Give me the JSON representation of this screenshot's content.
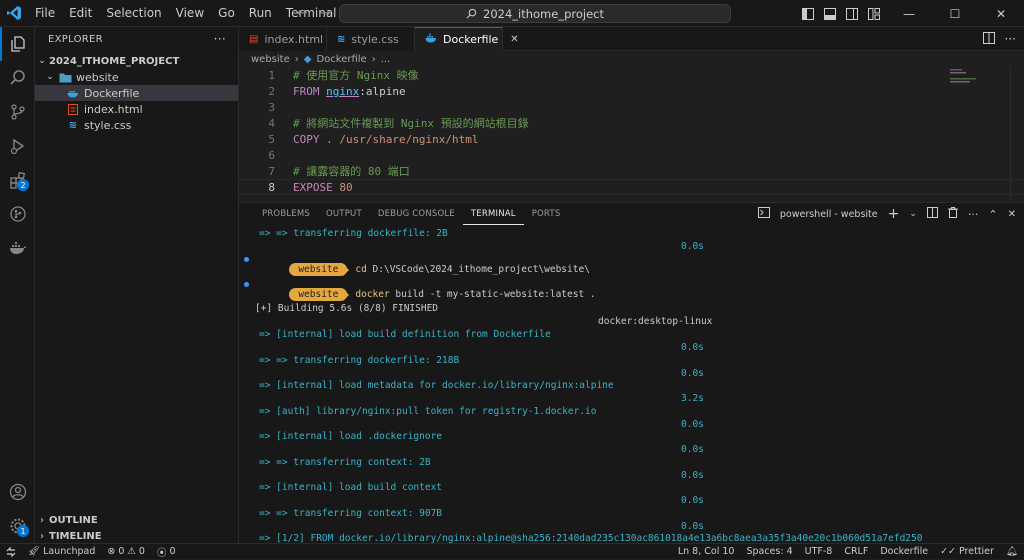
{
  "menu": [
    "File",
    "Edit",
    "Selection",
    "View",
    "Go",
    "Run",
    "Terminal",
    "Help"
  ],
  "command_center": "2024_ithome_project",
  "explorer": {
    "title": "EXPLORER",
    "project": "2024_ITHOME_PROJECT",
    "folder": "website",
    "files": [
      {
        "name": "Dockerfile",
        "icon": "docker-file-icon"
      },
      {
        "name": "index.html",
        "icon": "html-file-icon"
      },
      {
        "name": "style.css",
        "icon": "css-file-icon"
      }
    ],
    "outline": "OUTLINE",
    "timeline": "TIMELINE"
  },
  "tabs": [
    {
      "label": "index.html"
    },
    {
      "label": "style.css"
    },
    {
      "label": "Dockerfile"
    }
  ],
  "breadcrumb": {
    "folder": "website",
    "file": "Dockerfile",
    "tail": "..."
  },
  "code": [
    {
      "n": "1",
      "parts": [
        {
          "t": "# 使用官方 Nginx 映像",
          "c": "c-comment"
        }
      ]
    },
    {
      "n": "2",
      "parts": [
        {
          "t": "FROM ",
          "c": "c-kw"
        },
        {
          "t": "nginx",
          "c": "c-orange"
        },
        {
          "t": ":alpine",
          "c": "c-orange"
        }
      ]
    },
    {
      "n": "3",
      "parts": []
    },
    {
      "n": "4",
      "parts": [
        {
          "t": "# 將網站文件複製到 Nginx 預設的網站根目錄",
          "c": "c-comment"
        }
      ]
    },
    {
      "n": "5",
      "parts": [
        {
          "t": "COPY ",
          "c": "c-kw"
        },
        {
          "t": ". /usr/share/nginx/html",
          "c": "c-orange"
        }
      ]
    },
    {
      "n": "6",
      "parts": []
    },
    {
      "n": "7",
      "parts": [
        {
          "t": "# 讓露容器的 80 端口",
          "c": "c-comment"
        }
      ]
    },
    {
      "n": "8",
      "parts": [
        {
          "t": "EXPOSE ",
          "c": "c-kw"
        },
        {
          "t": "80",
          "c": "c-orange"
        }
      ]
    }
  ],
  "panel_tabs": [
    "PROBLEMS",
    "OUTPUT",
    "DEBUG CONSOLE",
    "TERMINAL",
    "PORTS"
  ],
  "terminal_name": "powershell - website",
  "terminal": {
    "l1": "=> => transferring dockerfile: 2B",
    "l1t": "0.0s",
    "prompt1": "website",
    "cmd1_a": "cd",
    "cmd1_b": " D:\\VSCode\\2024_ithome_project\\website\\",
    "prompt2": "website",
    "cmd2_a": "docker",
    "cmd2_b": " build -t my-static-website:latest .",
    "building": "[+] Building 5.6s (8/8) FINISHED",
    "builder": "docker:desktop-linux",
    "steps": [
      {
        "text": "=> [internal] load build definition from Dockerfile",
        "time": "0.0s"
      },
      {
        "text": "=> => transferring dockerfile: 218B",
        "time": "0.0s"
      },
      {
        "text": "=> [internal] load metadata for docker.io/library/nginx:alpine",
        "time": "3.2s"
      },
      {
        "text": "=> [auth] library/nginx:pull token for registry-1.docker.io",
        "time": "0.0s"
      },
      {
        "text": "=> [internal] load .dockerignore",
        "time": "0.0s"
      },
      {
        "text": "=> => transferring context: 2B",
        "time": "0.0s"
      },
      {
        "text": "=> [internal] load build context",
        "time": "0.0s"
      },
      {
        "text": "=> => transferring context: 907B",
        "time": "0.0s"
      },
      {
        "text": "=> [1/2] FROM docker.io/library/nginx:alpine@sha256:2140dad235c130ac861018a4e13a6bc8aea3a35f3a40e20c1b060d51a7efd250",
        "time": ""
      }
    ]
  },
  "status": {
    "launchpad": "Launchpad",
    "errors": "0",
    "warnings": "0",
    "ports": "0",
    "position": "Ln 8, Col 10",
    "spaces": "Spaces: 4",
    "encoding": "UTF-8",
    "eol": "CRLF",
    "language": "Dockerfile",
    "prettier": "Prettier"
  },
  "colors": {
    "accent": "#0078d4",
    "prompt": "#e5a740",
    "terminal_cyan": "#3ab3c9"
  }
}
